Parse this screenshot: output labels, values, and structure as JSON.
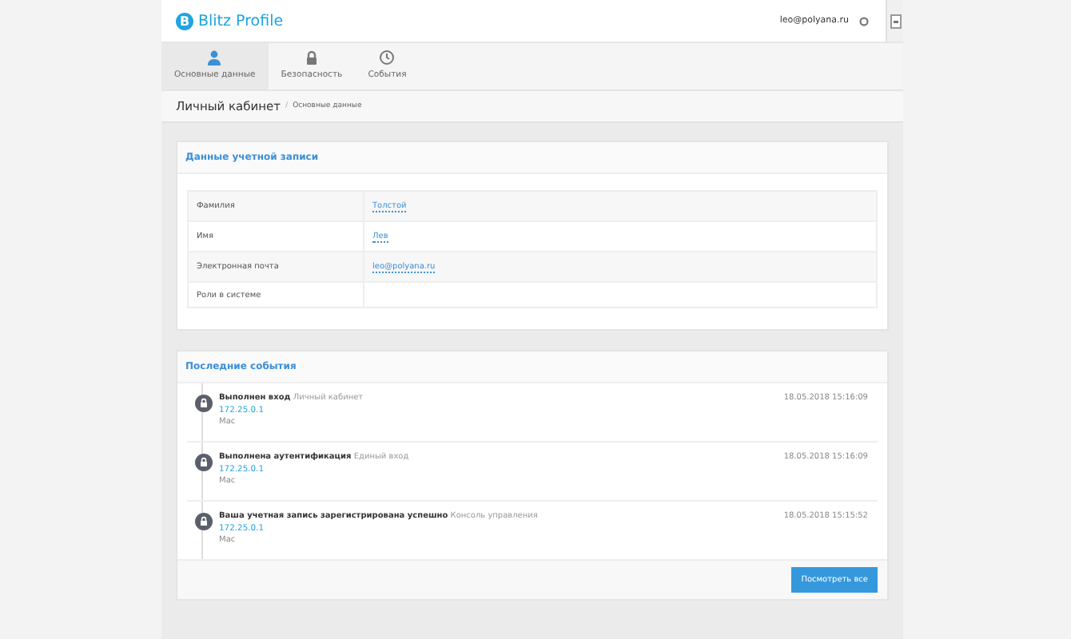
{
  "header": {
    "logo_letter": "B",
    "brand": "Blitz Profile",
    "user_email": "leo@polyana.ru"
  },
  "tabs": [
    {
      "label": "Основные данные",
      "kind": "profile",
      "selected": true
    },
    {
      "label": "Безопасность",
      "kind": "security",
      "selected": false
    },
    {
      "label": "События",
      "kind": "events",
      "selected": false
    }
  ],
  "breadcrumb": {
    "title": "Личный кабинет",
    "separator": "/",
    "current": "Основные данные"
  },
  "account_card": {
    "title": "Данные учетной записи",
    "rows": [
      {
        "label": "Фамилия",
        "value": "Толстой"
      },
      {
        "label": "Имя",
        "value": "Лев"
      },
      {
        "label": "Электронная почта",
        "value": "leo@polyana.ru"
      },
      {
        "label": "Роли в системе"
      }
    ]
  },
  "events_card": {
    "title": "Последние события",
    "events": [
      {
        "title": "Выполнен вход",
        "source": "Личный кабинет",
        "ip": "172.25.0.1",
        "device": "Mac",
        "time": "18.05.2018 15:16:09"
      },
      {
        "title": "Выполнена аутентификация",
        "source": "Единый вход",
        "ip": "172.25.0.1",
        "device": "Mac",
        "time": "18.05.2018 15:16:09"
      },
      {
        "title": "Ваша учетная запись зарегистрирована успешно",
        "source": "Консоль управления",
        "ip": "172.25.0.1",
        "device": "Mac",
        "time": "18.05.2018 15:15:52"
      }
    ],
    "button": "Посмотреть все"
  }
}
